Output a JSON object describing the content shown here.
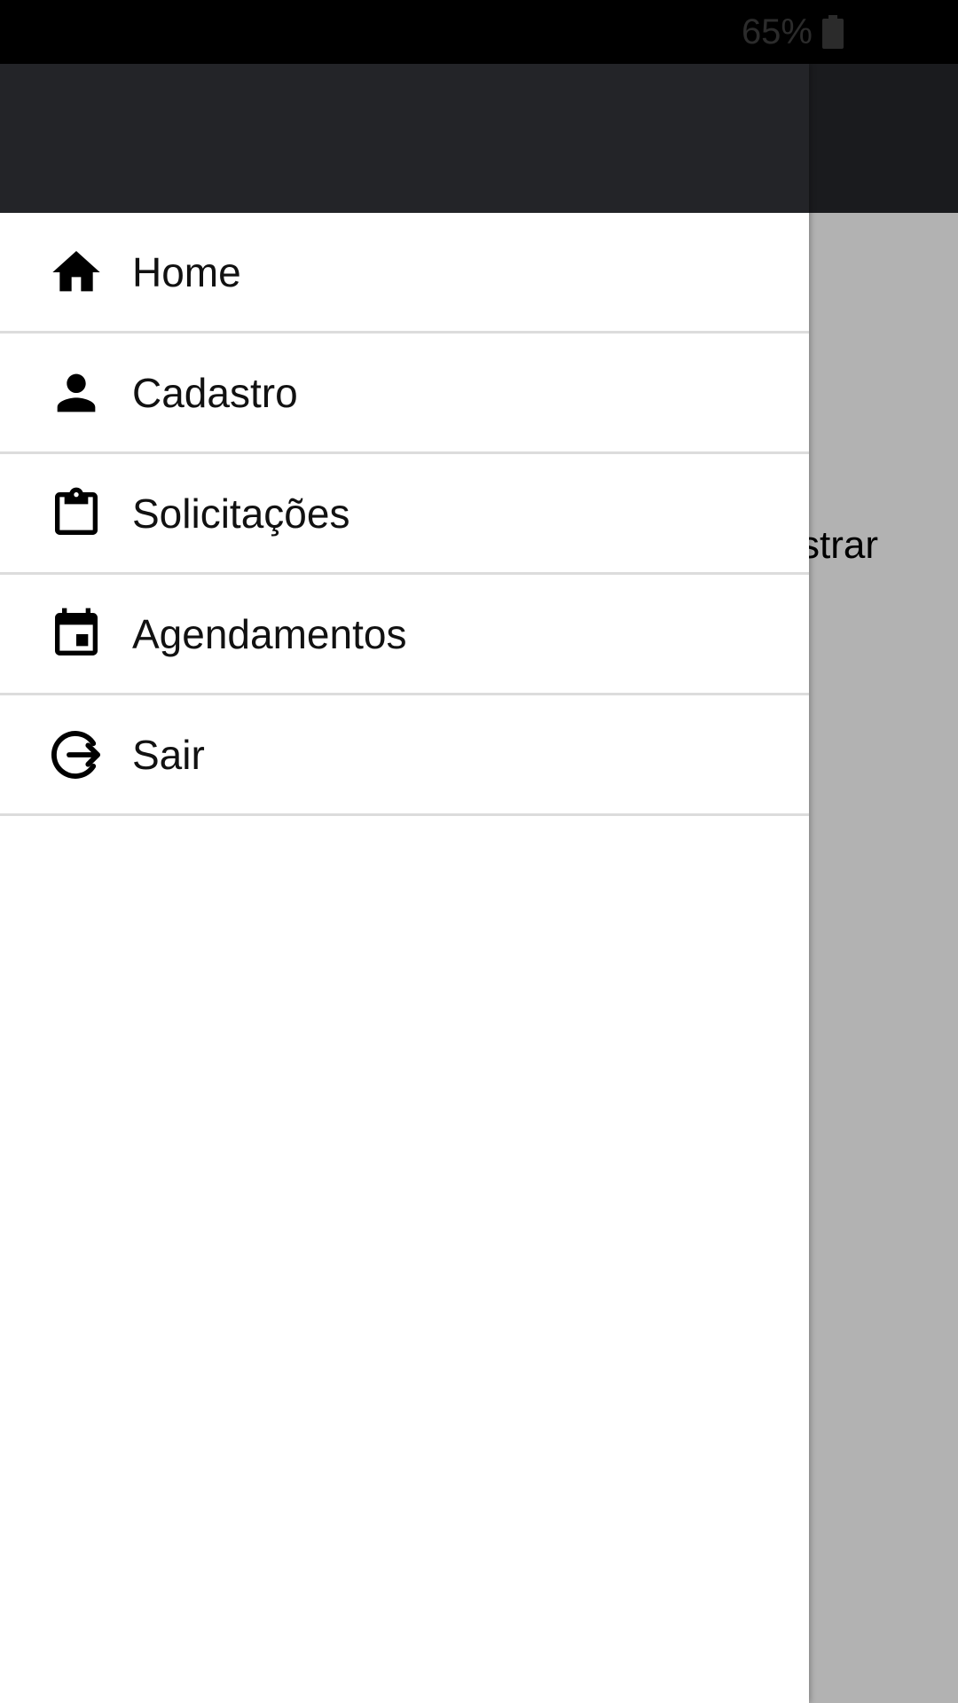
{
  "status_bar": {
    "battery_text": "65%",
    "battery_icon": "battery-icon"
  },
  "background": {
    "partial_text": "strar"
  },
  "drawer": {
    "items": [
      {
        "label": "Home",
        "icon": "home-icon"
      },
      {
        "label": "Cadastro",
        "icon": "person-icon"
      },
      {
        "label": "Solicitações",
        "icon": "clipboard-icon"
      },
      {
        "label": "Agendamentos",
        "icon": "calendar-icon"
      },
      {
        "label": "Sair",
        "icon": "logout-icon"
      }
    ]
  },
  "colors": {
    "status_bar": "#000000",
    "app_bar": "#232428",
    "drawer_bg": "#ffffff",
    "scrim_content": "#b2b2b2",
    "divider": "#dcdcdc"
  }
}
